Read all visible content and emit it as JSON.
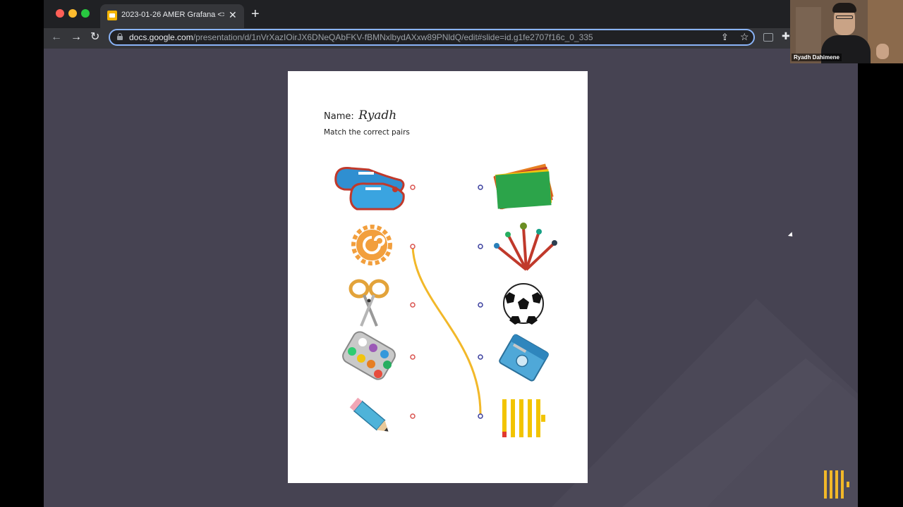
{
  "browser": {
    "tab_title": "2023-01-26 AMER Grafana <>",
    "url_host": "docs.google.com",
    "url_path": "/presentation/d/1nVrXazIOirJX6DNeQAbFKV-fBMNxlbydAXxw89PNldQ/edit#slide=id.g1fe2707f16c_0_335",
    "icons": {
      "back": "arrow-left-icon",
      "forward": "arrow-right-icon",
      "reload": "reload-icon",
      "close": "close-icon",
      "new_tab": "plus-icon",
      "share": "share-icon",
      "bookmark": "star-icon",
      "extension": "puzzle-icon"
    }
  },
  "slide": {
    "name_label": "Name:",
    "name_value": "Ryadh",
    "instruction": "Match the correct pairs",
    "left_items": [
      "sneakers",
      "grafana-logo",
      "scissors",
      "paint-palette",
      "pencil"
    ],
    "right_items": [
      "colored-paper",
      "paint-brushes",
      "soccer-ball",
      "pencil-sharpener",
      "brand-logo"
    ],
    "connections": [
      {
        "from": "grafana-logo",
        "to": "brand-logo"
      }
    ],
    "colors": {
      "left_dot": "#d9534f",
      "right_dot": "#3b3f9e",
      "connector": "#f2b829"
    }
  },
  "webcam": {
    "participant_name": "Ryadh Dahimene"
  },
  "overlay": {
    "brand_logo_color": "#f2b829"
  }
}
